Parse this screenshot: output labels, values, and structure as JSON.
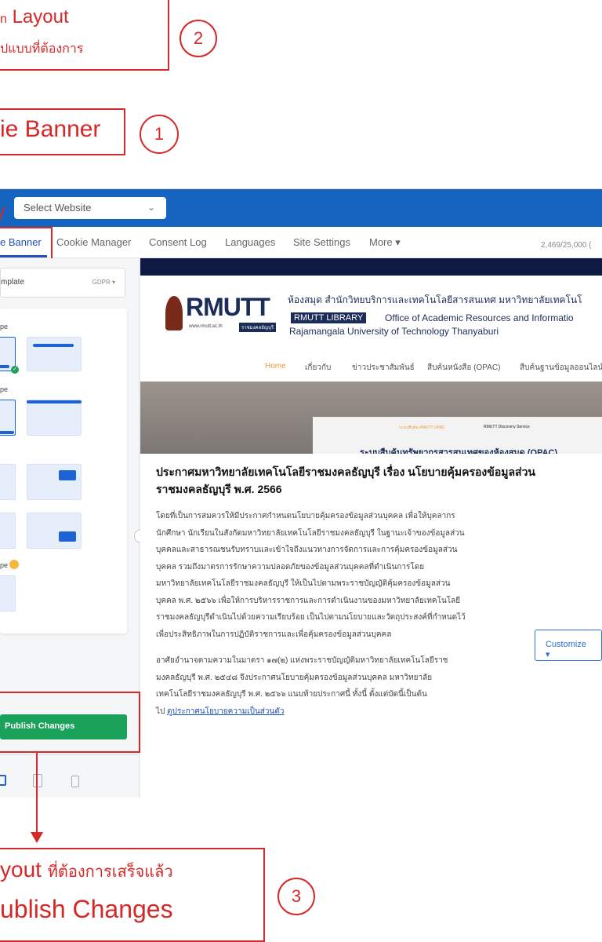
{
  "annotations": {
    "step2": {
      "line1_prefix": "n",
      "line1": "Layout",
      "line2": "ปแบบที่ต้องการ",
      "number": "2"
    },
    "step1": {
      "label": "ie Banner",
      "number": "1"
    },
    "step3": {
      "line1_a": "yout",
      "line1_b": "ที่ต้องการเสร็จแล้ว",
      "line2": "ublish Changes",
      "number": "3"
    }
  },
  "app": {
    "website_select": "Select Website",
    "tabs": [
      "e Banner",
      "Cookie Manager",
      "Consent Log",
      "Languages",
      "Site Settings",
      "More ▾"
    ],
    "usage": "2,469/25,000 (",
    "template_label": "mplate",
    "template_value": "GDPR ▾",
    "section_labels": [
      "pe",
      "pe",
      "pe"
    ],
    "publish_button": "Publish Changes",
    "customize_button": "Customize ▾",
    "colors": {
      "primary": "#1565c0",
      "publish": "#1aa25b",
      "annotation": "#d62828"
    }
  },
  "site": {
    "logo_text": "RMUTT",
    "logo_url": "www.rmutt.ac.th",
    "logo_sub": "ราชมงคลธัญบุรี",
    "header_thai": "ห้องสมุด สำนักวิทยบริการและเทคโนโลยีสารสนเทศ มหาวิทยาลัยเทคโนโ",
    "library_badge": "RMUTT LIBRARY",
    "office": "Office of Academic Resources and Informatio",
    "university": "Rajamangala University of Technology Thanyaburi",
    "menu": [
      "Home",
      "เกี่ยวกับ",
      "ข่าวประชาสัมพันธ์",
      "สืบค้นหนังสือ (OPAC)",
      "สืบค้นฐานข้อมูลออนไลน์"
    ],
    "hero_tabs": [
      "ระบบสืบค้น RMUTT OPAC",
      "RMUTT Discovery Service"
    ],
    "hero_caption": "ระบบสืบค้นทรัพยากรสารสนเทศของห้องสมุด (OPAC)",
    "title_line1": "ประกาศมหาวิทยาลัยเทคโนโลยีราชมงคลธัญบุรี เรื่อง นโยบายคุ้มครองข้อมูลส่วน",
    "title_line2": "ราชมงคลธัญบุรี พ.ศ. 2566",
    "para1": [
      "โดยที่เป็นการสมควรให้มีประกาศกำหนดนโยบายคุ้มครองข้อมูลส่วนบุคคล เพื่อให้บุคลากร",
      "นักศึกษา นักเรียนในสังกัดมหาวิทยาลัยเทคโนโลยีราชมงคลธัญบุรี ในฐานะเจ้าของข้อมูลส่วน",
      "บุคคลและสาธารณชนรับทราบและเข้าใจถึงแนวทางการจัดการและการคุ้มครองข้อมูลส่วน",
      "บุคคล รวมถึงมาตรการรักษาความปลอดภัยของข้อมูลส่วนบุคคลที่ดำเนินการโดย",
      "มหาวิทยาลัยเทคโนโลยีราชมงคลธัญบุรี ให้เป็นไปตามพระราชบัญญัติคุ้มครองข้อมูลส่วน",
      "บุคคล พ.ศ. ๒๕๖๖ เพื่อให้การบริหารราชการและการดำเนินงานของมหาวิทยาลัยเทคโนโลยี",
      "ราชมงคลธัญบุรีดำเนินไปด้วยความเรียบร้อย เป็นไปตามนโยบายและวัตถุประสงค์ที่กำหนดไว้",
      "เพื่อประสิทธิภาพในการปฏิบัติราชการและเพื่อคุ้มครองข้อมูลส่วนบุคคล"
    ],
    "para2": [
      "อาศัยอำนาจตามความในมาตรา ๑๗(๒) แห่งพระราชบัญญัติมหาวิทยาลัยเทคโนโลยีราช",
      "มงคลธัญบุรี พ.ศ. ๒๕๔๘ จึงประกาศนโยบายคุ้มครองข้อมูลส่วนบุคคล มหาวิทยาลัย",
      "เทคโนโลยีราชมงคลธัญบุรี พ.ศ. ๒๕๖๖ แนบท้ายประกาศนี้ ทั้งนี้ ตั้งแต่บัดนี้เป็นต้น"
    ],
    "para2_last_prefix": "ไป",
    "policy_link": "ดูประกาศนโยบายความเป็นส่วนตัว"
  }
}
